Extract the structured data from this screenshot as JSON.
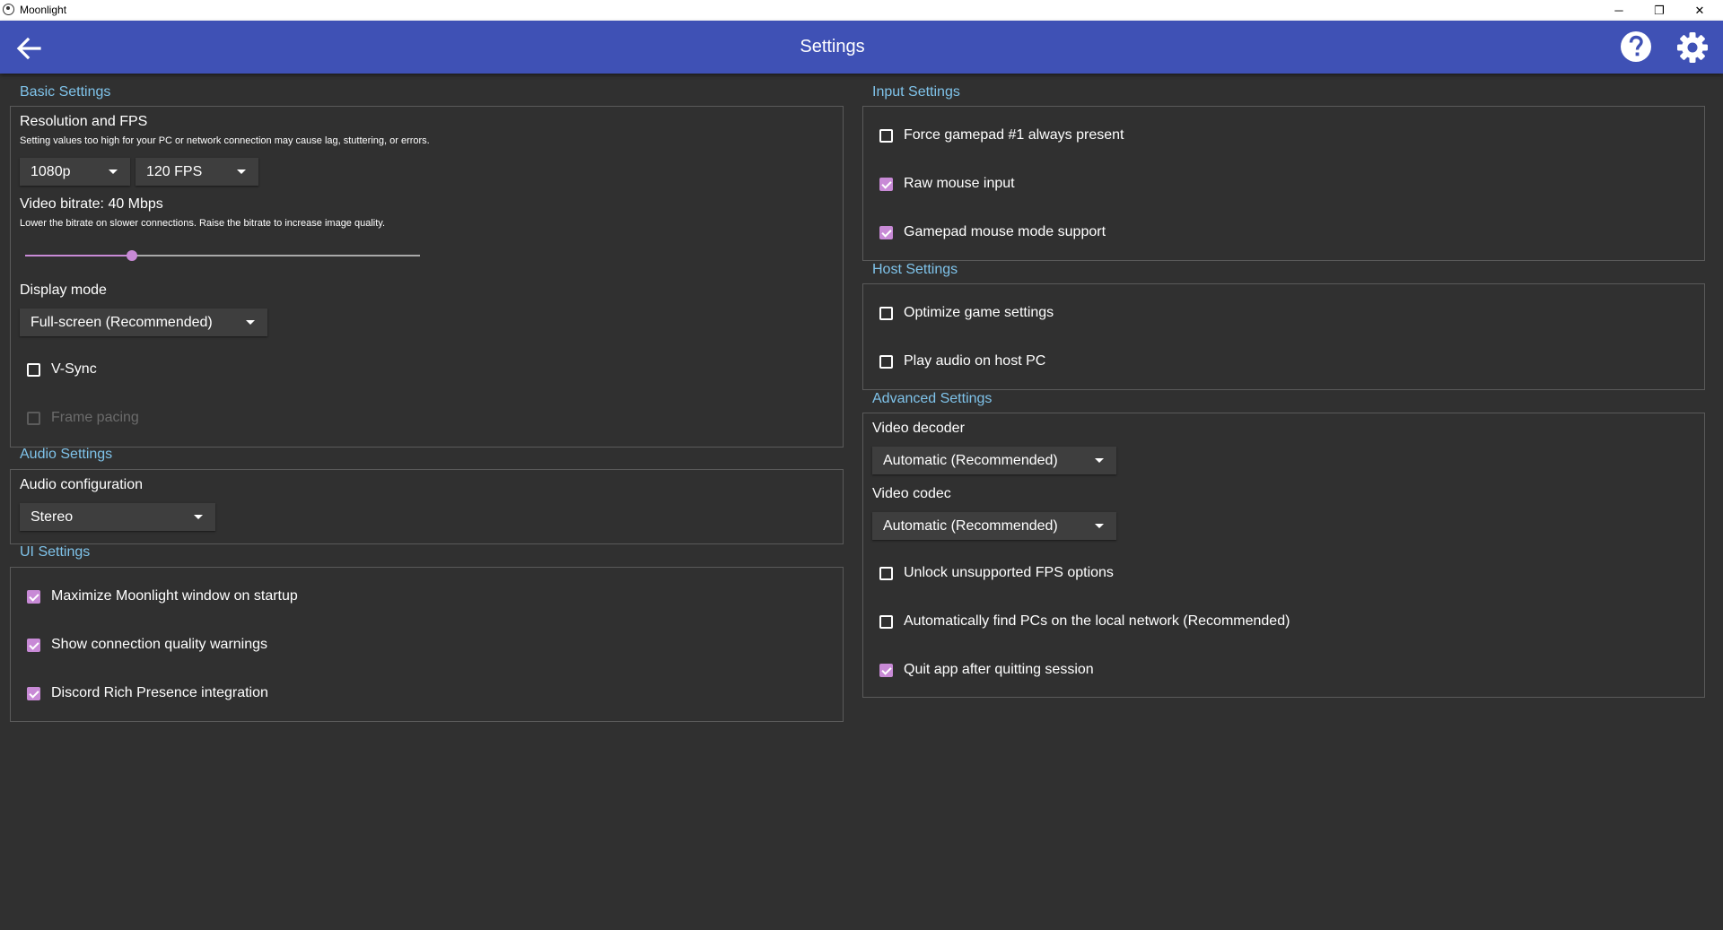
{
  "window": {
    "title": "Moonlight",
    "minimize_glyph": "─",
    "maximize_glyph": "❐",
    "close_glyph": "✕"
  },
  "header": {
    "title": "Settings",
    "back_icon": "arrow-left-icon",
    "help_icon": "help-circle-icon",
    "settings_icon": "gear-icon"
  },
  "theme": {
    "accent": "#c88ad6",
    "header_bg": "#3f51b5",
    "section_heading": "#7fc3ea",
    "background": "#303030"
  },
  "basic": {
    "heading": "Basic Settings",
    "resolution_label": "Resolution and FPS",
    "resolution_hint": "Setting values too high for your PC or network connection may cause lag, stuttering, or errors.",
    "resolution_value": "1080p",
    "fps_value": "120 FPS",
    "bitrate_label": "Video bitrate: 40 Mbps",
    "bitrate_hint": "Lower the bitrate on slower connections. Raise the bitrate to increase image quality.",
    "bitrate_fraction": 0.27,
    "display_mode_label": "Display mode",
    "display_mode_value": "Full-screen (Recommended)",
    "vsync_label": "V-Sync",
    "vsync_checked": false,
    "frame_pacing_label": "Frame pacing",
    "frame_pacing_checked": false,
    "frame_pacing_enabled": false
  },
  "audio": {
    "heading": "Audio Settings",
    "config_label": "Audio configuration",
    "config_value": "Stereo"
  },
  "ui": {
    "heading": "UI Settings",
    "items": [
      {
        "label": "Maximize Moonlight window on startup",
        "checked": true
      },
      {
        "label": "Show connection quality warnings",
        "checked": true
      },
      {
        "label": "Discord Rich Presence integration",
        "checked": true
      }
    ]
  },
  "input": {
    "heading": "Input Settings",
    "items": [
      {
        "label": "Force gamepad #1 always present",
        "checked": false
      },
      {
        "label": "Raw mouse input",
        "checked": true
      },
      {
        "label": "Gamepad mouse mode support",
        "checked": true
      }
    ]
  },
  "host": {
    "heading": "Host Settings",
    "items": [
      {
        "label": "Optimize game settings",
        "checked": false
      },
      {
        "label": "Play audio on host PC",
        "checked": false
      }
    ]
  },
  "advanced": {
    "heading": "Advanced Settings",
    "decoder_label": "Video decoder",
    "decoder_value": "Automatic (Recommended)",
    "codec_label": "Video codec",
    "codec_value": "Automatic (Recommended)",
    "items": [
      {
        "label": "Unlock unsupported FPS options",
        "checked": false
      },
      {
        "label": "Automatically find PCs on the local network (Recommended)",
        "checked": false
      },
      {
        "label": "Quit app after quitting session",
        "checked": true
      }
    ]
  }
}
